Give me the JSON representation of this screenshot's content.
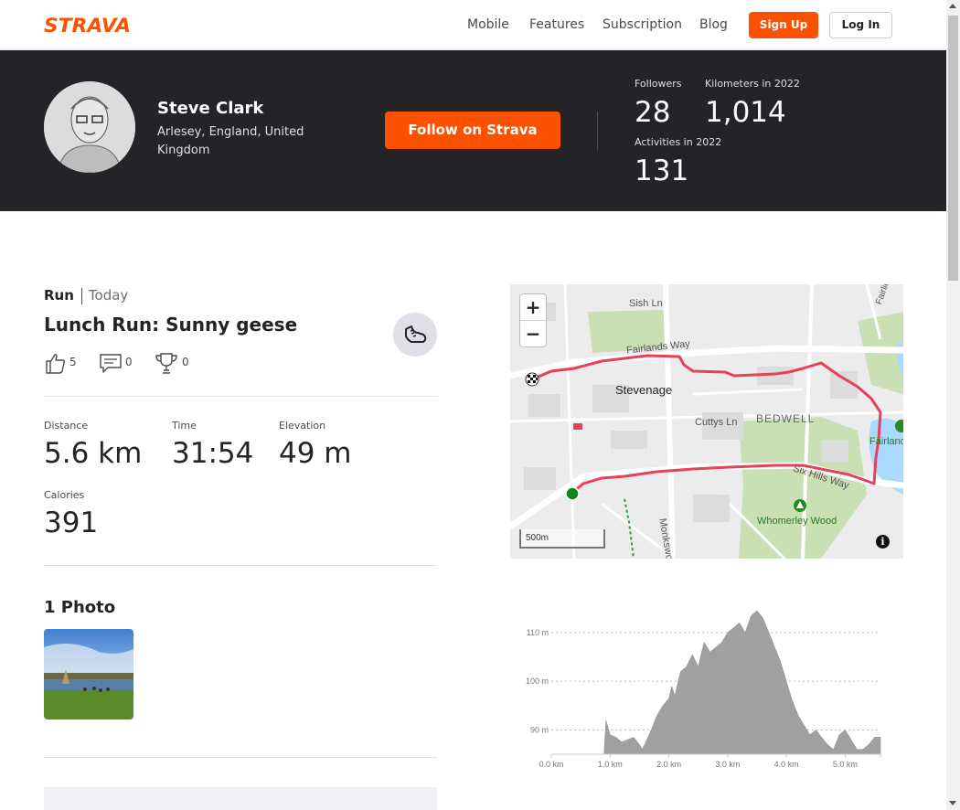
{
  "nav": {
    "logo_text": "STRAVA",
    "links": [
      "Mobile",
      "Features",
      "Subscription",
      "Blog"
    ],
    "signup_label": "Sign Up",
    "login_label": "Log In",
    "brand_color": "#fc5200"
  },
  "athlete": {
    "name": "Steve Clark",
    "location": "Arlesey, England, United Kingdom",
    "follow_label": "Follow on Strava",
    "stats": {
      "followers_label": "Followers",
      "followers": "28",
      "km_label": "Kilometers in 2022",
      "km": "1,014",
      "activities_label": "Activities in 2022",
      "activities": "131"
    }
  },
  "activity": {
    "type": "Run",
    "date": "Today",
    "title": "Lunch Run: Sunny geese",
    "kudos": "5",
    "comments": "0",
    "achievements": "0",
    "metrics": {
      "distance_label": "Distance",
      "distance": "5.6 km",
      "time_label": "Time",
      "time": "31:54",
      "elevation_label": "Elevation",
      "elevation": "49 m",
      "calories_label": "Calories",
      "calories": "391"
    },
    "photos_heading": "1 Photo"
  },
  "map": {
    "zoom_in": "+",
    "zoom_out": "−",
    "scale": "500m",
    "info": "i",
    "labels": {
      "sish": "Sish Ln",
      "fairlands": "Fairlands Way",
      "stevenage": "Stevenage",
      "cuttys": "Cuttys Ln",
      "bedwell": "BEDWELL",
      "sixhills": "Six Hills Way",
      "monkswood": "Monkswood",
      "whomerley": "Whomerley Wood",
      "fairlands_valley": "Fairlands",
      "fairlie": "Fairlie"
    },
    "route_color": "#e6405a"
  },
  "chart_data": {
    "type": "area",
    "title": "",
    "xlabel": "",
    "ylabel": "",
    "x_ticks": [
      "0.0 km",
      "1.0 km",
      "2.0 km",
      "3.0 km",
      "4.0 km",
      "5.0 km"
    ],
    "y_ticks": [
      "90 m",
      "100 m",
      "110 m"
    ],
    "xlim": [
      0,
      5.6
    ],
    "ylim": [
      85,
      116
    ],
    "grid": true,
    "fill_color": "#a0a0a0",
    "series": [
      {
        "x": [
          0.9,
          0.93,
          1.0,
          1.1,
          1.2,
          1.3,
          1.4,
          1.5,
          1.55,
          1.7,
          1.8,
          1.9,
          2.0,
          2.05,
          2.1,
          2.2,
          2.3,
          2.4,
          2.5,
          2.6,
          2.7,
          2.8,
          2.9,
          3.0,
          3.1,
          3.2,
          3.3,
          3.4,
          3.5,
          3.6,
          3.7,
          3.8,
          3.9,
          4.0,
          4.1,
          4.2,
          4.3,
          4.4,
          4.5,
          4.6,
          4.7,
          4.8,
          4.9,
          5.0,
          5.1,
          5.2,
          5.3,
          5.4,
          5.5,
          5.6
        ],
        "y": [
          86,
          92,
          89,
          88.5,
          87.5,
          88,
          88.5,
          87,
          86,
          90,
          93,
          95,
          96.5,
          99,
          97,
          102,
          103,
          105.5,
          103,
          108,
          106,
          107,
          108,
          110,
          111,
          112,
          110,
          113.5,
          114.5,
          113,
          110,
          107,
          104,
          100,
          96,
          93,
          91,
          89,
          90,
          88.5,
          87,
          86,
          89,
          90,
          88,
          86,
          86,
          87,
          88.5,
          88.5
        ]
      }
    ]
  }
}
